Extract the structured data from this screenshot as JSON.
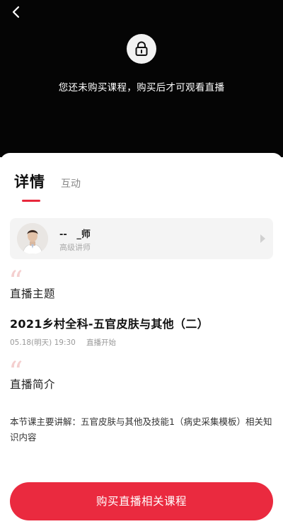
{
  "player": {
    "back_icon": "chevron-left-icon",
    "lock_icon": "lock-icon",
    "lock_message": "您还未购买课程，购买后才可观看直播"
  },
  "tabs": {
    "active_label": "详情",
    "items": [
      {
        "label": "详情",
        "active": true
      },
      {
        "label": "互动",
        "active": false
      }
    ]
  },
  "teacher": {
    "name": "--   _师",
    "title": "高级讲师",
    "arrow_icon": "chevron-right-icon"
  },
  "live_topic": {
    "heading": "直播主题",
    "course_title": "2021乡村全科-五官皮肤与其他（二）",
    "time": "05.18(明天) 19:30",
    "status": "直播开始"
  },
  "live_intro": {
    "heading": "直播简介",
    "text": "本节课主要讲解：五官皮肤与其他及技能1（病史采集模板）相关知识内容"
  },
  "footer": {
    "buy_label": "购买直播相关课程"
  },
  "colors": {
    "accent": "#ea2a3f",
    "player_bg": "#050505",
    "card_bg": "#f4f4f4",
    "quote": "#f4cfcf"
  }
}
